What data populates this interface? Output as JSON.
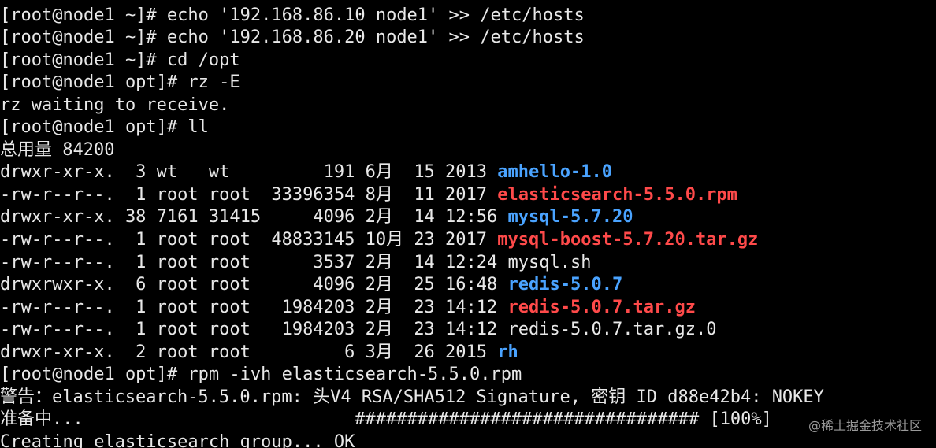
{
  "terminal": {
    "lines": {
      "l0": "[root@node1 ~]# echo '192.168.86.10 node1' >> /etc/hosts",
      "l1": "[root@node1 ~]# echo '192.168.86.20 node1' >> /etc/hosts",
      "l2": "[root@node1 ~]# cd /opt",
      "l3": "[root@node1 opt]# rz -E",
      "l4": "rz waiting to receive.",
      "l5": "[root@node1 opt]# ll",
      "l6": "总用量 84200",
      "l16": "[root@node1 opt]# rpm -ivh elasticsearch-5.5.0.rpm",
      "l17": "警告：elasticsearch-5.5.0.rpm: 头V4 RSA/SHA512 Signature, 密钥 ID d88e42b4: NOKEY",
      "l18": "准备中...                          ################################# [100%]",
      "l19": "Creating elasticsearch group... OK"
    },
    "listing": [
      {
        "meta": "drwxr-xr-x.  3 wt   wt         191 6月  15 2013 ",
        "name": "amhello-1.0",
        "kind": "dir"
      },
      {
        "meta": "-rw-r--r--.  1 root root  33396354 8月  11 2017 ",
        "name": "elasticsearch-5.5.0.rpm",
        "kind": "archive"
      },
      {
        "meta": "drwxr-xr-x. 38 7161 31415     4096 2月  14 12:56 ",
        "name": "mysql-5.7.20",
        "kind": "dir"
      },
      {
        "meta": "-rw-r--r--.  1 root root  48833145 10月 23 2017 ",
        "name": "mysql-boost-5.7.20.tar.gz",
        "kind": "archive"
      },
      {
        "meta": "-rw-r--r--.  1 root root      3537 2月  14 12:24 ",
        "name": "mysql.sh",
        "kind": "file"
      },
      {
        "meta": "drwxrwxr-x.  6 root root      4096 2月  25 16:48 ",
        "name": "redis-5.0.7",
        "kind": "dir"
      },
      {
        "meta": "-rw-r--r--.  1 root root   1984203 2月  23 14:12 ",
        "name": "redis-5.0.7.tar.gz",
        "kind": "archive"
      },
      {
        "meta": "-rw-r--r--.  1 root root   1984203 2月  23 14:12 ",
        "name": "redis-5.0.7.tar.gz.0",
        "kind": "file"
      },
      {
        "meta": "drwxr-xr-x.  2 root root         6 3月  26 2015 ",
        "name": "rh",
        "kind": "dir"
      }
    ]
  },
  "watermark": "@稀土掘金技术社区",
  "colors": {
    "background": "#000000",
    "text": "#e8e8e8",
    "directory": "#4aa3ff",
    "archive": "#ff4a4a",
    "watermark": "#9a9a9a"
  }
}
